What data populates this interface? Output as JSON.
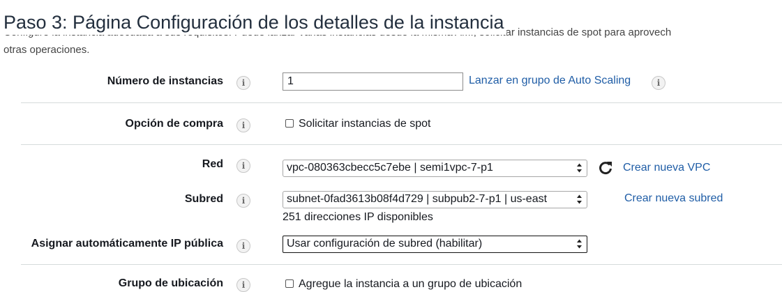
{
  "header": {
    "title": "Paso 3: Página Configuración de los detalles de la instancia",
    "description_line1": "Configure la instancia adecuada a sus requisitos. Puede lanzar varias instancias desde la misma AMI, solicitar instancias de spot para aprovech",
    "description_line2": "otras operaciones."
  },
  "fields": {
    "num_instances": {
      "label": "Número de instancias",
      "value": "1",
      "link": "Lanzar en grupo de Auto Scaling"
    },
    "purchase_option": {
      "label": "Opción de compra",
      "checkbox_label": "Solicitar instancias de spot",
      "checked": false
    },
    "network": {
      "label": "Red",
      "selected": "vpc-080363cbecc5c7ebe | semi1vpc-7-p1",
      "link": "Crear nueva VPC"
    },
    "subnet": {
      "label": "Subred",
      "selected": "subnet-0fad3613b08f4d729 | subpub2-7-p1 | us-east",
      "hint": "251 direcciones IP disponibles",
      "link": "Crear nueva subred"
    },
    "public_ip": {
      "label": "Asignar automáticamente IP pública",
      "selected": "Usar configuración de subred (habilitar)"
    },
    "placement_group": {
      "label": "Grupo de ubicación",
      "checkbox_label": "Agregue la instancia a un grupo de ubicación",
      "checked": false
    }
  },
  "icons": {
    "info": "info-icon",
    "refresh": "refresh-icon",
    "select_arrows": "select-arrows-icon"
  },
  "colors": {
    "link": "#1f5da6",
    "title": "#232f3e",
    "divider": "#d5dbdb"
  }
}
